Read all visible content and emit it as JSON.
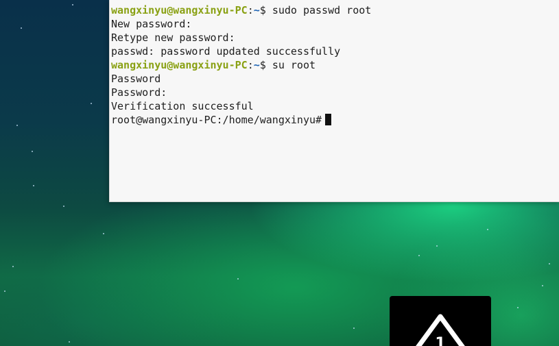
{
  "terminal": {
    "lines": [
      {
        "type": "text",
        "text": "Password:"
      },
      {
        "type": "prompt",
        "user": "wangxinyu@wangxinyu-PC",
        "sep": ":",
        "path": "~",
        "symbol": "$ ",
        "command": "sudo passwd root"
      },
      {
        "type": "text",
        "text": "New password:"
      },
      {
        "type": "text",
        "text": "Retype new password:"
      },
      {
        "type": "text",
        "text": "passwd: password updated successfully"
      },
      {
        "type": "prompt",
        "user": "wangxinyu@wangxinyu-PC",
        "sep": ":",
        "path": "~",
        "symbol": "$ ",
        "command": "su root"
      },
      {
        "type": "text",
        "text": "Password"
      },
      {
        "type": "text",
        "text": "Password:"
      },
      {
        "type": "text",
        "text": "Verification successful"
      },
      {
        "type": "text",
        "text": "root@wangxinyu-PC:/home/wangxinyu#"
      }
    ]
  },
  "colors": {
    "prompt_user": "#8aa114",
    "prompt_path": "#1e64b4",
    "terminal_bg": "#f7f7f7",
    "aurora_green": "#1ee68c"
  },
  "widget": {
    "icon": "warning-triangle-icon",
    "badge_text": "1"
  }
}
